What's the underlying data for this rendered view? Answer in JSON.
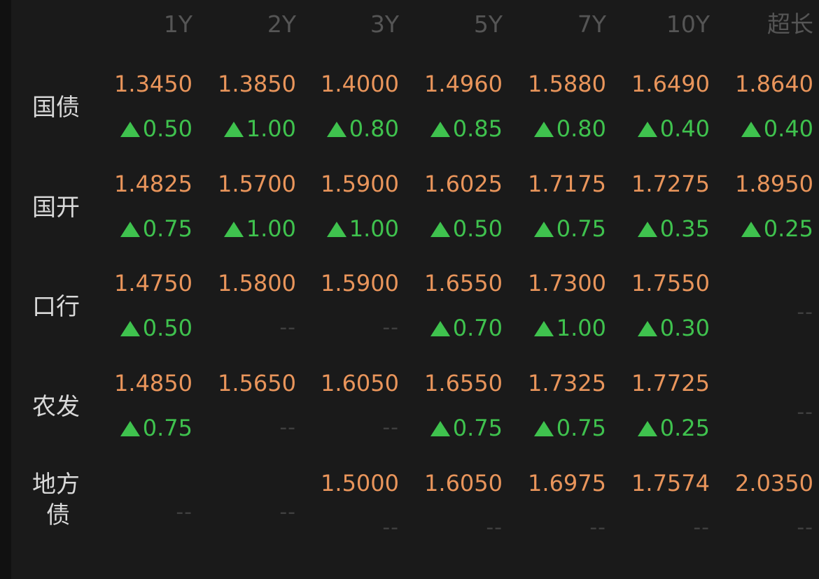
{
  "columns": [
    "1Y",
    "2Y",
    "3Y",
    "5Y",
    "7Y",
    "10Y",
    "超长"
  ],
  "rows": [
    {
      "label_lines": [
        "国债"
      ],
      "cells": [
        {
          "value": "1.3450",
          "change": "0.50"
        },
        {
          "value": "1.3850",
          "change": "1.00"
        },
        {
          "value": "1.4000",
          "change": "0.80"
        },
        {
          "value": "1.4960",
          "change": "0.85"
        },
        {
          "value": "1.5880",
          "change": "0.80"
        },
        {
          "value": "1.6490",
          "change": "0.40"
        },
        {
          "value": "1.8640",
          "change": "0.40"
        }
      ]
    },
    {
      "label_lines": [
        "国开"
      ],
      "cells": [
        {
          "value": "1.4825",
          "change": "0.75"
        },
        {
          "value": "1.5700",
          "change": "1.00"
        },
        {
          "value": "1.5900",
          "change": "1.00"
        },
        {
          "value": "1.6025",
          "change": "0.50"
        },
        {
          "value": "1.7175",
          "change": "0.75"
        },
        {
          "value": "1.7275",
          "change": "0.35"
        },
        {
          "value": "1.8950",
          "change": "0.25"
        }
      ]
    },
    {
      "label_lines": [
        "口行"
      ],
      "cells": [
        {
          "value": "1.4750",
          "change": "0.50"
        },
        {
          "value": "1.5800",
          "change": "--"
        },
        {
          "value": "1.5900",
          "change": "--"
        },
        {
          "value": "1.6550",
          "change": "0.70"
        },
        {
          "value": "1.7300",
          "change": "1.00"
        },
        {
          "value": "1.7550",
          "change": "0.30"
        },
        {
          "value": "--",
          "change": ""
        }
      ]
    },
    {
      "label_lines": [
        "农发"
      ],
      "cells": [
        {
          "value": "1.4850",
          "change": "0.75"
        },
        {
          "value": "1.5650",
          "change": "--"
        },
        {
          "value": "1.6050",
          "change": "--"
        },
        {
          "value": "1.6550",
          "change": "0.75"
        },
        {
          "value": "1.7325",
          "change": "0.75"
        },
        {
          "value": "1.7725",
          "change": "0.25"
        },
        {
          "value": "--",
          "change": ""
        }
      ]
    },
    {
      "label_lines": [
        "地方",
        "债"
      ],
      "cells": [
        {
          "value": "--",
          "change": ""
        },
        {
          "value": "--",
          "change": ""
        },
        {
          "value": "1.5000",
          "change": "--"
        },
        {
          "value": "1.6050",
          "change": "--"
        },
        {
          "value": "1.6975",
          "change": "--"
        },
        {
          "value": "1.7574",
          "change": "--"
        },
        {
          "value": "2.0350",
          "change": "--"
        }
      ]
    }
  ],
  "colors": {
    "background": "#1a1a1a",
    "value": "#e9955b",
    "change_up": "#3fc24e",
    "header": "#555555",
    "label": "#d9d9d9",
    "empty": "#3f3f3f"
  },
  "icons": {
    "change_up": "triangle-up-icon"
  }
}
